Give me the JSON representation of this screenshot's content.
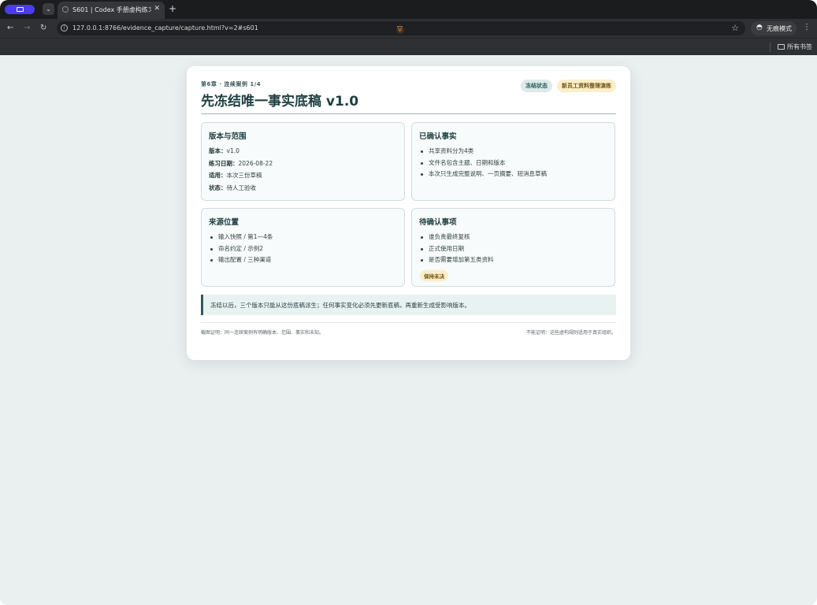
{
  "browser": {
    "tab_title": "S601 | Codex 手册虚构练习广",
    "tab_close": "✕",
    "new_tab": "+",
    "tab_search": "⌄",
    "url": "127.0.0.1:8766/evidence_capture/capture.html?v=2#s601",
    "incognito_label": "无痕模式",
    "bookmark_folder": "所有书签"
  },
  "header": {
    "eyebrow": "第6章 · 连续案例 1/4",
    "title": "先冻结唯一事实底稿 v1.0",
    "badges": [
      "冻结状态",
      "新员工资料整理演练"
    ]
  },
  "scope": {
    "heading": "版本与范围",
    "rows": [
      {
        "key": "版本：",
        "value": "v1.0"
      },
      {
        "key": "练习日期：",
        "value": "2026-08-22"
      },
      {
        "key": "适用：",
        "value": "本次三份草稿"
      },
      {
        "key": "状态：",
        "value": "待人工验收"
      }
    ]
  },
  "confirmed": {
    "heading": "已确认事实",
    "items": [
      "共享资料分为4类",
      "文件名包含主题、日期和版本",
      "本次只生成完整说明、一页摘要、短消息草稿"
    ]
  },
  "sources": {
    "heading": "来源位置",
    "items": [
      "输入快照 / 第1—4条",
      "命名约定 / 示例2",
      "输出配置 / 三种渠道"
    ]
  },
  "pending": {
    "heading": "待确认事项",
    "items": [
      "谁负责最终复核",
      "正式使用日期",
      "是否需要增加第五类资料"
    ],
    "tag": "保持未决"
  },
  "note": "冻结以后，三个版本只能从这份底稿派生；任何事实变化必须先更新底稿，再重新生成受影响版本。",
  "footer": {
    "left": "截图证明：同一连续案例有明确版本、范围、事实和未知。",
    "right": "不能证明：这些虚构规则适用于真实组织。"
  },
  "colors": {
    "accent": "#2e5a5c",
    "amber_badge": "#fbeec8",
    "page_bg": "#eaf0ef"
  }
}
